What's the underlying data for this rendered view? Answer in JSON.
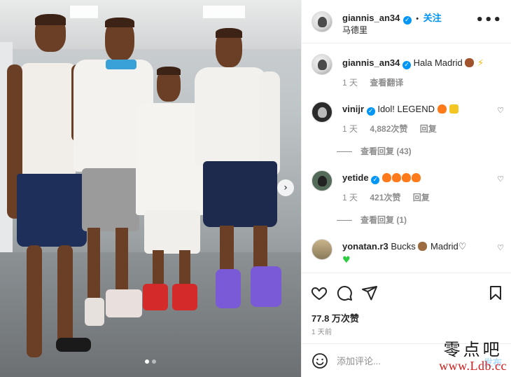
{
  "post": {
    "username": "giannis_an34",
    "follow_label": "关注",
    "separator": "•",
    "location": "马德里",
    "more_label": "•••",
    "photo_next": "›",
    "carousel": {
      "count": 2,
      "active": 1
    }
  },
  "caption": {
    "username": "giannis_an34",
    "text": "Hala Madrid",
    "time": "1 天",
    "translate_label": "查看翻译"
  },
  "comments": [
    {
      "username": "vinijr",
      "verified": true,
      "text": "Idol! LEGEND",
      "emojis": [
        "fire-emoji",
        "crown-emoji"
      ],
      "time": "1 天",
      "likes": "4,882次赞",
      "reply_label": "回复",
      "view_replies": "查看回复 (43)"
    },
    {
      "username": "yetide",
      "verified": true,
      "text": "",
      "emojis": [
        "fire-emoji",
        "fire-emoji",
        "fire-emoji",
        "fire-emoji"
      ],
      "time": "1 天",
      "likes": "421次赞",
      "reply_label": "回复",
      "view_replies": "查看回复 (1)"
    },
    {
      "username": "yonatan.r3",
      "verified": false,
      "text_before": "Bucks",
      "text_after": "Madrid",
      "emojis": [
        "deer-emoji",
        "white-heart-emoji",
        "green-heart-emoji"
      ]
    }
  ],
  "actions": {
    "likes": "77.8 万次赞",
    "posted": "1 天前"
  },
  "add_comment": {
    "placeholder": "添加评论...",
    "post_label": "发布"
  },
  "watermark": {
    "top": "零点吧",
    "bottom": "www.Ldb.cc"
  },
  "colors": {
    "accent": "#0095f6",
    "post_disabled": "#b2dffc",
    "watermark_red": "#d11a1a"
  }
}
